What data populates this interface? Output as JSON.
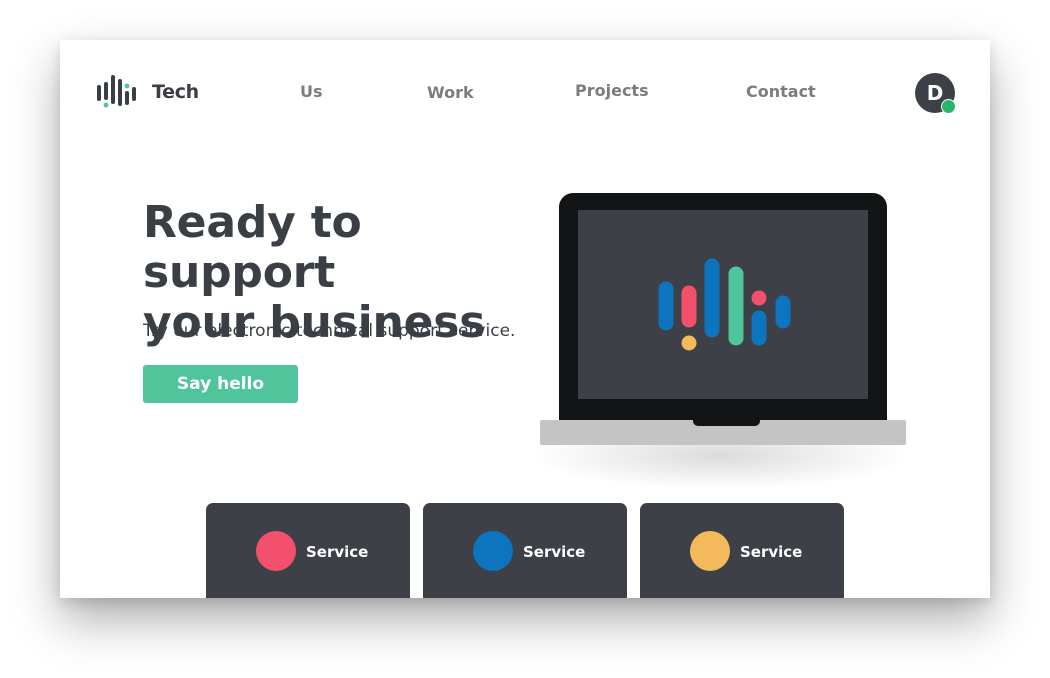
{
  "header": {
    "brand": "Tech",
    "nav": [
      {
        "label": "Us"
      },
      {
        "label": "Work"
      },
      {
        "label": "Projects"
      },
      {
        "label": "Contact"
      }
    ],
    "avatar_initial": "D",
    "status_color": "#27b46c"
  },
  "hero": {
    "title_line1": "Ready to support",
    "title_line2": "your business",
    "subtitle": "Try our electronic technical support service.",
    "cta_label": "Say hello"
  },
  "illustration": {
    "icon": "laptop-with-logo",
    "logo_colors": [
      "#0d74bf",
      "#f2506c",
      "#f4b95a",
      "#50c49a"
    ]
  },
  "services": [
    {
      "label": "Service",
      "color": "#f2506c"
    },
    {
      "label": "Service",
      "color": "#0d74bf"
    },
    {
      "label": "Service",
      "color": "#f4b95a"
    }
  ],
  "colors": {
    "accent": "#50c49a",
    "dark": "#3d4047",
    "text": "#3a3e45"
  }
}
